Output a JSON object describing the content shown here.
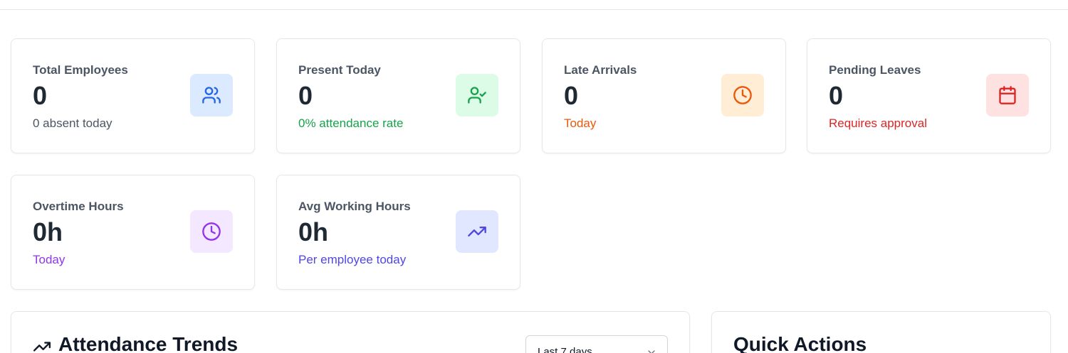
{
  "stats": [
    {
      "label": "Total Employees",
      "value": "0",
      "sub": "0 absent today",
      "icon": "users-icon",
      "accent": "#2563eb",
      "bg": "#dbeafe",
      "subColor": "#4b5563"
    },
    {
      "label": "Present Today",
      "value": "0",
      "sub": "0% attendance rate",
      "icon": "user-check-icon",
      "accent": "#16a34a",
      "bg": "#dcfce7",
      "subColor": "#16a34a"
    },
    {
      "label": "Late Arrivals",
      "value": "0",
      "sub": "Today",
      "icon": "clock-icon",
      "accent": "#ea580c",
      "bg": "#ffedd5",
      "subColor": "#ea580c"
    },
    {
      "label": "Pending Leaves",
      "value": "0",
      "sub": "Requires approval",
      "icon": "calendar-icon",
      "accent": "#dc2626",
      "bg": "#fee2e2",
      "subColor": "#dc2626"
    },
    {
      "label": "Overtime Hours",
      "value": "0h",
      "sub": "Today",
      "icon": "clock-icon",
      "accent": "#9333ea",
      "bg": "#f3e8ff",
      "subColor": "#9333ea"
    },
    {
      "label": "Avg Working Hours",
      "value": "0h",
      "sub": "Per employee today",
      "icon": "trending-up-icon",
      "accent": "#4f46e5",
      "bg": "#e0e7ff",
      "subColor": "#4f46e5"
    }
  ],
  "trends": {
    "title": "Attendance Trends",
    "range_selected": "Last 7 days"
  },
  "quick_actions": {
    "title": "Quick Actions"
  }
}
